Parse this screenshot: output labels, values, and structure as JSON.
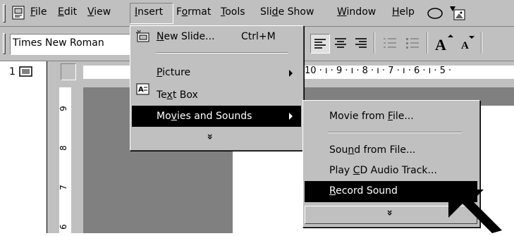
{
  "menubar": {
    "items": [
      {
        "pre": "",
        "u": "F",
        "post": "ile"
      },
      {
        "pre": "",
        "u": "E",
        "post": "dit"
      },
      {
        "pre": "",
        "u": "V",
        "post": "iew"
      },
      {
        "pre": "",
        "u": "I",
        "post": "nsert"
      },
      {
        "pre": "F",
        "u": "o",
        "post": "rmat"
      },
      {
        "pre": "",
        "u": "T",
        "post": "ools"
      },
      {
        "pre": "Sli",
        "u": "d",
        "post": "e Show"
      },
      {
        "pre": "",
        "u": "W",
        "post": "indow"
      },
      {
        "pre": "",
        "u": "H",
        "post": "elp"
      }
    ]
  },
  "toolbar": {
    "font_name": "Times New Roman"
  },
  "outline": {
    "slide_number": "1"
  },
  "ruler": {
    "horizontal": "10 · ı · 9 · ı · 8 · ı · 7 · ı · 6 · ı · 5 ·",
    "vertical_marks": [
      "9",
      "8",
      "7",
      "6"
    ]
  },
  "insert_menu": {
    "new_slide": {
      "pre": "",
      "u": "N",
      "post": "ew Slide...",
      "shortcut": "Ctrl+M"
    },
    "picture": {
      "pre": "",
      "u": "P",
      "post": "icture"
    },
    "text_box": {
      "pre": "Te",
      "u": "x",
      "post": "t Box"
    },
    "movies_sounds": {
      "pre": "Mo",
      "u": "v",
      "post": "ies and Sounds"
    },
    "expand": "»"
  },
  "sub_menu": {
    "movie_file": {
      "pre": "Movie from ",
      "u": "F",
      "post": "ile..."
    },
    "sound_file": {
      "pre": "Sou",
      "u": "n",
      "post": "d from File..."
    },
    "cd_audio": {
      "pre": "Play ",
      "u": "C",
      "post": "D Audio Track..."
    },
    "record": {
      "pre": "",
      "u": "R",
      "post": "ecord Sound"
    },
    "expand": "»"
  },
  "colors": {
    "menu_bg": "#c0c0c0",
    "highlight": "#000000",
    "highlight_text": "#ffffff",
    "slide_gray": "#808080"
  }
}
